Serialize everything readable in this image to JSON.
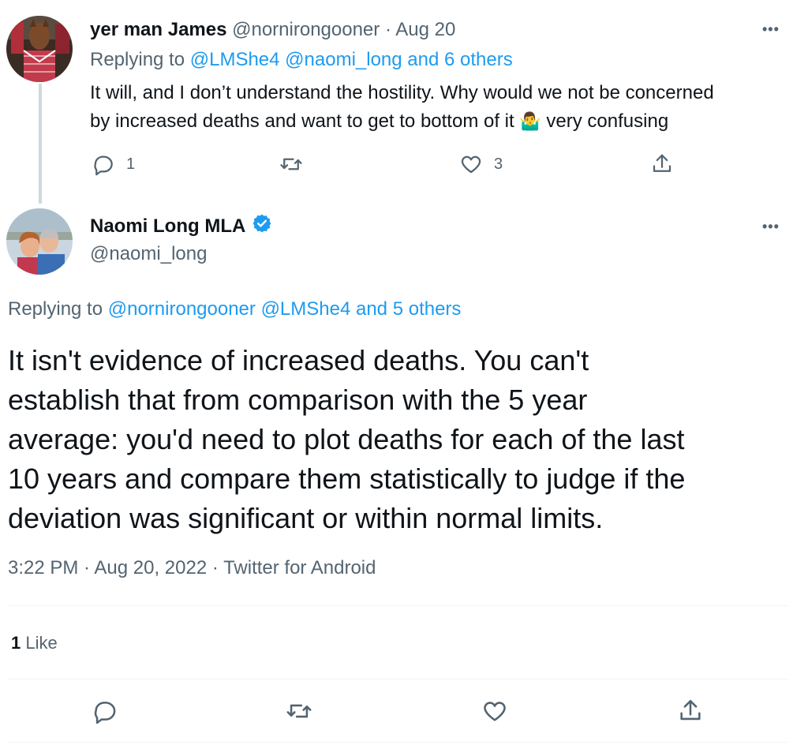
{
  "reply_tweet": {
    "display_name": "yer man James",
    "handle": "@nornirongooner",
    "separator": "·",
    "date": "Aug 20",
    "replying_prefix": "Replying to",
    "replying_targets": "@LMShe4 @naomi_long and 6 others",
    "text_line1": "It will, and I don’t understand the hostility. Why would we not be concerned",
    "text_line2_a": "by increased deaths and want to get to bottom of it",
    "emoji": "🤷‍♂️",
    "text_line2_b": " very confusing",
    "reply_count": "1",
    "retweet_count": "",
    "like_count": "3"
  },
  "main_tweet": {
    "display_name": "Naomi Long MLA",
    "handle": "@naomi_long",
    "replying_prefix": "Replying to",
    "replying_targets": "@nornirongooner @LMShe4 and 5 others",
    "text_lines": [
      "It isn't evidence of increased deaths. You can't",
      "establish that from comparison with the 5 year",
      "average: you'd need to plot deaths for each of the last",
      "10 years and compare them statistically to judge if the",
      "deviation was significant or within normal limits."
    ],
    "timestamp": "3:22 PM · Aug 20, 2022 · Twitter for Android",
    "likes_count": "1",
    "likes_label": "Like"
  },
  "menu": {
    "more_label": "•••"
  },
  "colors": {
    "accent": "#1d9bf0",
    "muted": "#536471",
    "text": "#0f1419",
    "border": "#eff3f4"
  }
}
